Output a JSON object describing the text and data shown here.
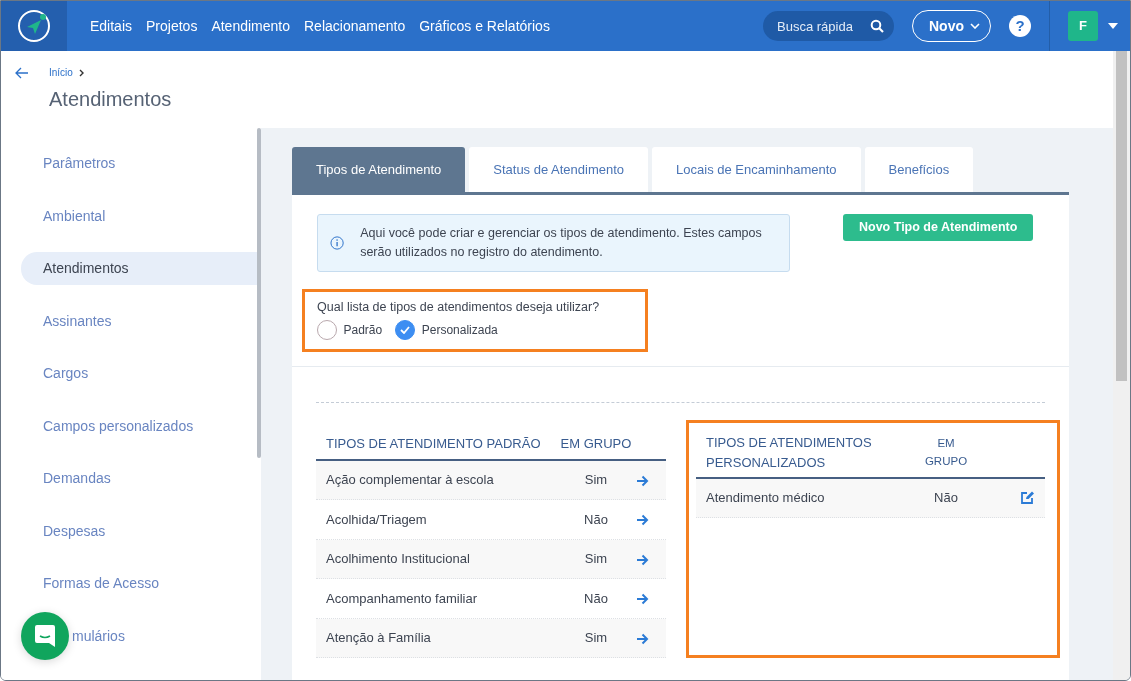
{
  "navbar": {
    "menu": [
      "Editais",
      "Projetos",
      "Atendimento",
      "Relacionamento",
      "Gráficos e Relatórios"
    ],
    "search": {
      "placeholder": "Busca rápida"
    },
    "new_button": "Novo",
    "help": "?",
    "avatar": "F"
  },
  "breadcrumb": {
    "items": [
      "Início"
    ]
  },
  "page_title": "Atendimentos",
  "sidebar": {
    "items": [
      {
        "label": "Parâmetros",
        "selected": false
      },
      {
        "label": "Ambiental",
        "selected": false
      },
      {
        "label": "Atendimentos",
        "selected": true
      },
      {
        "label": "Assinantes",
        "selected": false
      },
      {
        "label": "Cargos",
        "selected": false
      },
      {
        "label": "Campos personalizados",
        "selected": false
      },
      {
        "label": "Demandas",
        "selected": false
      },
      {
        "label": "Despesas",
        "selected": false
      },
      {
        "label": "Formas de Acesso",
        "selected": false
      },
      {
        "label": "mulários",
        "selected": false
      }
    ]
  },
  "tabs": [
    {
      "label": "Tipos de Atendimento",
      "selected": true
    },
    {
      "label": "Status de Atendimento",
      "selected": false
    },
    {
      "label": "Locais de Encaminhamento",
      "selected": false
    },
    {
      "label": "Benefícios",
      "selected": false
    }
  ],
  "info_text": "Aqui você pode criar e gerenciar os tipos de atendimento. Estes campos serão utilizados no registro do atendimento.",
  "new_type_button": "Novo Tipo de Atendimento",
  "list_choice": {
    "question": "Qual lista de tipos de atendimentos deseja utilizar?",
    "options": [
      {
        "label": "Padrão",
        "selected": false
      },
      {
        "label": "Personalizada",
        "selected": true
      }
    ]
  },
  "default_table": {
    "columns": [
      "TIPOS DE ATENDIMENTO PADRÃO",
      "EM GRUPO"
    ],
    "rows": [
      {
        "name": "Ação complementar à escola",
        "group": "Sim"
      },
      {
        "name": "Acolhida/Triagem",
        "group": "Não"
      },
      {
        "name": "Acolhimento Institucional",
        "group": "Sim"
      },
      {
        "name": "Acompanhamento familiar",
        "group": "Não"
      },
      {
        "name": "Atenção à Família",
        "group": "Sim"
      }
    ]
  },
  "custom_table": {
    "columns": [
      "TIPOS DE ATENDIMENTOS PERSONALIZADOS",
      "EM GRUPO"
    ],
    "rows": [
      {
        "name": "Atendimento médico",
        "group": "Não"
      }
    ]
  }
}
